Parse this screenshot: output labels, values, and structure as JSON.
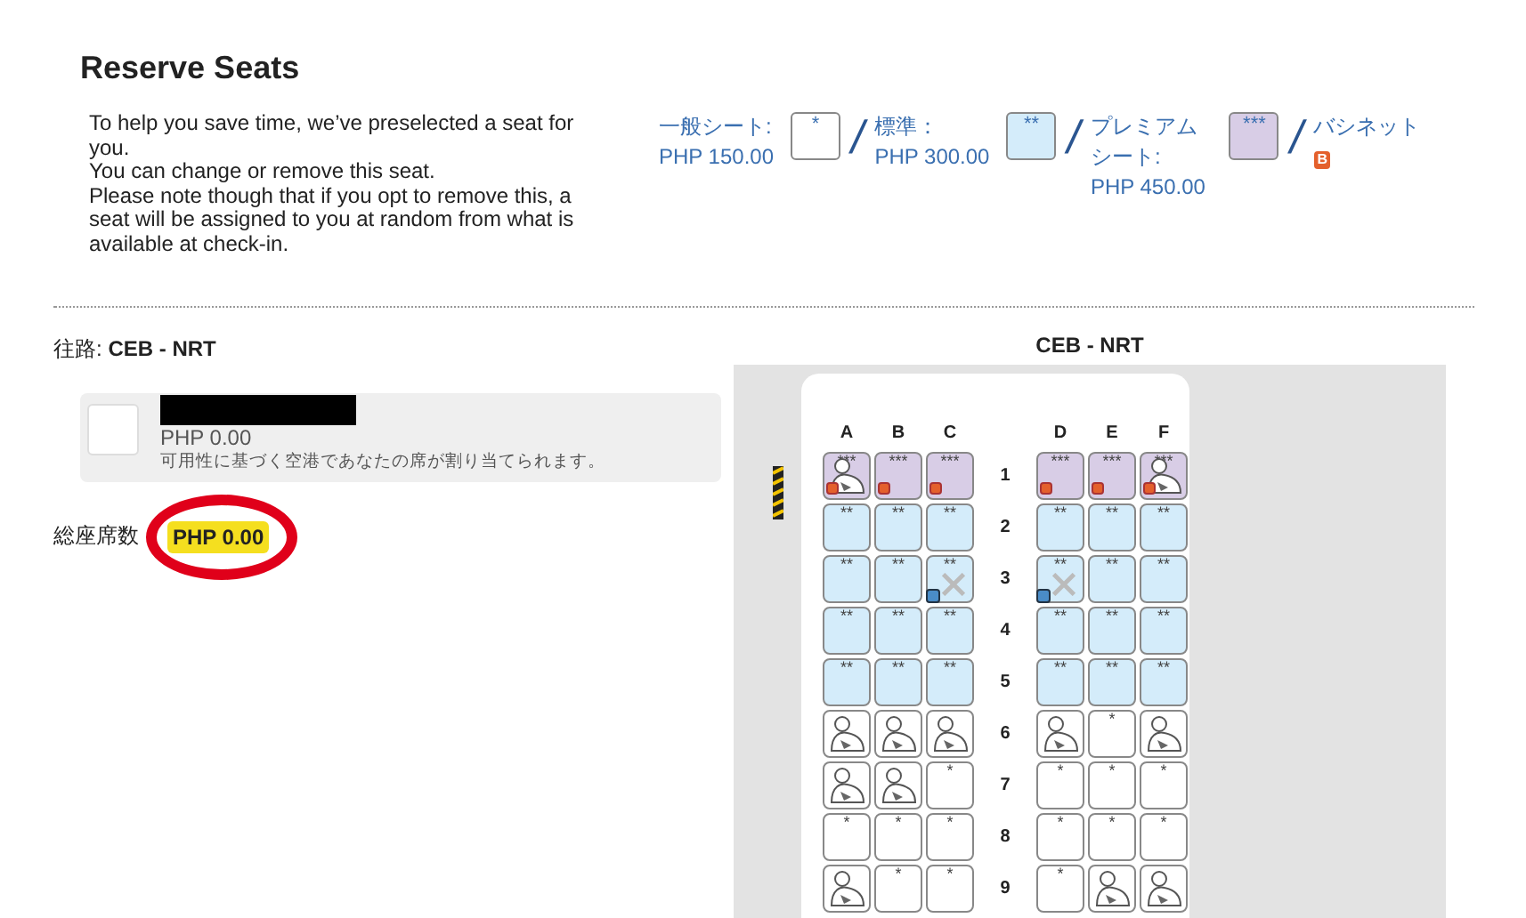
{
  "title": "Reserve Seats",
  "intro": [
    "To help you save time, we’ve preselected a seat for you.",
    "You can change or remove this seat.",
    "Please note though that if you opt to remove this, a seat will be assigned to you at random from what is available at check-in."
  ],
  "legend": [
    {
      "kind": "economy",
      "label": "一般シート:",
      "price": "PHP 150.00",
      "swatch": "*"
    },
    {
      "kind": "standard",
      "label": "標準：",
      "price": "PHP 300.00",
      "swatch": "**"
    },
    {
      "kind": "premium",
      "label": "プレミアムシート:",
      "price": "PHP 450.00",
      "swatch": "***"
    },
    {
      "kind": "bassinet",
      "label": "バシネット",
      "badge": "B"
    }
  ],
  "separator": "/",
  "route": {
    "label": "往路:",
    "value": "CEB - NRT"
  },
  "passenger": {
    "price": "PHP 0.00",
    "note": "可用性に基づく空港であなたの席が割り当てられます。"
  },
  "total": {
    "label": "総座席数",
    "value": "PHP 0.00"
  },
  "seat_map": {
    "title": "CEB - NRT",
    "columns": [
      {
        "label": "A"
      },
      {
        "label": "B"
      },
      {
        "label": "C"
      },
      {
        "label": "D"
      },
      {
        "label": "E"
      },
      {
        "label": "F"
      }
    ],
    "rows": [
      {
        "number": "1",
        "seats": [
          {
            "kind": "premium",
            "label": "***",
            "occupied": true,
            "bassinet": true,
            "blocked": false
          },
          {
            "kind": "premium",
            "label": "***",
            "occupied": false,
            "bassinet": true,
            "blocked": false
          },
          {
            "kind": "premium",
            "label": "***",
            "occupied": false,
            "bassinet": true,
            "blocked": false
          },
          {
            "kind": "premium",
            "label": "***",
            "occupied": false,
            "bassinet": true,
            "blocked": false
          },
          {
            "kind": "premium",
            "label": "***",
            "occupied": false,
            "bassinet": true,
            "blocked": false
          },
          {
            "kind": "premium",
            "label": "***",
            "occupied": true,
            "bassinet": true,
            "blocked": false
          }
        ]
      },
      {
        "number": "2",
        "seats": [
          {
            "kind": "standard",
            "label": "**",
            "occupied": false,
            "bassinet": false,
            "blocked": false
          },
          {
            "kind": "standard",
            "label": "**",
            "occupied": false,
            "bassinet": false,
            "blocked": false
          },
          {
            "kind": "standard",
            "label": "**",
            "occupied": false,
            "bassinet": false,
            "blocked": false
          },
          {
            "kind": "standard",
            "label": "**",
            "occupied": false,
            "bassinet": false,
            "blocked": false
          },
          {
            "kind": "standard",
            "label": "**",
            "occupied": false,
            "bassinet": false,
            "blocked": false
          },
          {
            "kind": "standard",
            "label": "**",
            "occupied": false,
            "bassinet": false,
            "blocked": false
          }
        ]
      },
      {
        "number": "3",
        "seats": [
          {
            "kind": "standard",
            "label": "**",
            "occupied": false,
            "bassinet": false,
            "blocked": false
          },
          {
            "kind": "standard",
            "label": "**",
            "occupied": false,
            "bassinet": false,
            "blocked": false
          },
          {
            "kind": "standard",
            "label": "**",
            "occupied": false,
            "bassinet": false,
            "blocked": true
          },
          {
            "kind": "standard",
            "label": "**",
            "occupied": false,
            "bassinet": false,
            "blocked": true
          },
          {
            "kind": "standard",
            "label": "**",
            "occupied": false,
            "bassinet": false,
            "blocked": false
          },
          {
            "kind": "standard",
            "label": "**",
            "occupied": false,
            "bassinet": false,
            "blocked": false
          }
        ]
      },
      {
        "number": "4",
        "seats": [
          {
            "kind": "standard",
            "label": "**",
            "occupied": false,
            "bassinet": false,
            "blocked": false
          },
          {
            "kind": "standard",
            "label": "**",
            "occupied": false,
            "bassinet": false,
            "blocked": false
          },
          {
            "kind": "standard",
            "label": "**",
            "occupied": false,
            "bassinet": false,
            "blocked": false
          },
          {
            "kind": "standard",
            "label": "**",
            "occupied": false,
            "bassinet": false,
            "blocked": false
          },
          {
            "kind": "standard",
            "label": "**",
            "occupied": false,
            "bassinet": false,
            "blocked": false
          },
          {
            "kind": "standard",
            "label": "**",
            "occupied": false,
            "bassinet": false,
            "blocked": false
          }
        ]
      },
      {
        "number": "5",
        "seats": [
          {
            "kind": "standard",
            "label": "**",
            "occupied": false,
            "bassinet": false,
            "blocked": false
          },
          {
            "kind": "standard",
            "label": "**",
            "occupied": false,
            "bassinet": false,
            "blocked": false
          },
          {
            "kind": "standard",
            "label": "**",
            "occupied": false,
            "bassinet": false,
            "blocked": false
          },
          {
            "kind": "standard",
            "label": "**",
            "occupied": false,
            "bassinet": false,
            "blocked": false
          },
          {
            "kind": "standard",
            "label": "**",
            "occupied": false,
            "bassinet": false,
            "blocked": false
          },
          {
            "kind": "standard",
            "label": "**",
            "occupied": false,
            "bassinet": false,
            "blocked": false
          }
        ]
      },
      {
        "number": "6",
        "seats": [
          {
            "kind": "economy",
            "occupied": true,
            "bassinet": false,
            "blocked": false
          },
          {
            "kind": "economy",
            "occupied": true,
            "bassinet": false,
            "blocked": false
          },
          {
            "kind": "economy",
            "occupied": true,
            "bassinet": false,
            "blocked": false
          },
          {
            "kind": "economy",
            "occupied": true,
            "bassinet": false,
            "blocked": false
          },
          {
            "kind": "economy",
            "label": "*",
            "occupied": false,
            "bassinet": false,
            "blocked": false
          },
          {
            "kind": "economy",
            "occupied": true,
            "bassinet": false,
            "blocked": false
          }
        ]
      },
      {
        "number": "7",
        "seats": [
          {
            "kind": "economy",
            "occupied": true,
            "bassinet": false,
            "blocked": false
          },
          {
            "kind": "economy",
            "occupied": true,
            "bassinet": false,
            "blocked": false
          },
          {
            "kind": "economy",
            "label": "*",
            "occupied": false,
            "bassinet": false,
            "blocked": false
          },
          {
            "kind": "economy",
            "label": "*",
            "occupied": false,
            "bassinet": false,
            "blocked": false
          },
          {
            "kind": "economy",
            "label": "*",
            "occupied": false,
            "bassinet": false,
            "blocked": false
          },
          {
            "kind": "economy",
            "label": "*",
            "occupied": false,
            "bassinet": false,
            "blocked": false
          }
        ]
      },
      {
        "number": "8",
        "seats": [
          {
            "kind": "economy",
            "label": "*",
            "occupied": false,
            "bassinet": false,
            "blocked": false
          },
          {
            "kind": "economy",
            "label": "*",
            "occupied": false,
            "bassinet": false,
            "blocked": false
          },
          {
            "kind": "economy",
            "label": "*",
            "occupied": false,
            "bassinet": false,
            "blocked": false
          },
          {
            "kind": "economy",
            "label": "*",
            "occupied": false,
            "bassinet": false,
            "blocked": false
          },
          {
            "kind": "economy",
            "label": "*",
            "occupied": false,
            "bassinet": false,
            "blocked": false
          },
          {
            "kind": "economy",
            "label": "*",
            "occupied": false,
            "bassinet": false,
            "blocked": false
          }
        ]
      },
      {
        "number": "9",
        "seats": [
          {
            "kind": "economy",
            "occupied": true,
            "bassinet": false,
            "blocked": false
          },
          {
            "kind": "economy",
            "label": "*",
            "occupied": false,
            "bassinet": false,
            "blocked": false
          },
          {
            "kind": "economy",
            "label": "*",
            "occupied": false,
            "bassinet": false,
            "blocked": false
          },
          {
            "kind": "economy",
            "label": "*",
            "occupied": false,
            "bassinet": false,
            "blocked": false
          },
          {
            "kind": "economy",
            "occupied": true,
            "bassinet": false,
            "blocked": false
          },
          {
            "kind": "economy",
            "occupied": true,
            "bassinet": false,
            "blocked": false
          }
        ]
      }
    ]
  }
}
